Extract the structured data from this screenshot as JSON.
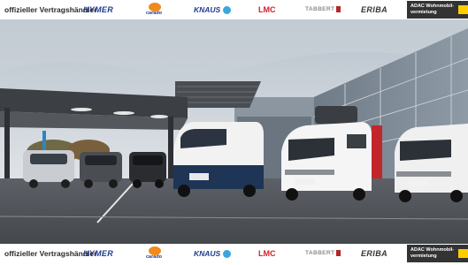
{
  "top_bar": {
    "dealer_text": "offizieller Vertragshändler",
    "brands": {
      "hymer": "HYMER",
      "carado": "carado",
      "knaus": "KNAUS",
      "lmc": "LMC",
      "tabbert": "TABBERT",
      "eriba": "ERIBA"
    },
    "adac": "ADAC Wohnmobil-vermietung"
  },
  "bottom_bar": {
    "dealer_text": "offizieller Vertragshändler",
    "brands": {
      "hymer": "HYMER",
      "carado": "carado",
      "knaus": "KNAUS",
      "lmc": "LMC",
      "tabbert": "TABBERT",
      "eriba": "ERIBA"
    },
    "adac": "ADAC Wohnmobil-vermietung"
  },
  "colors": {
    "hymer_blue": "#1f3b8f",
    "lmc_red": "#d3202a",
    "carado_orange": "#f08a1c",
    "adac_yellow": "#ffcc00"
  }
}
